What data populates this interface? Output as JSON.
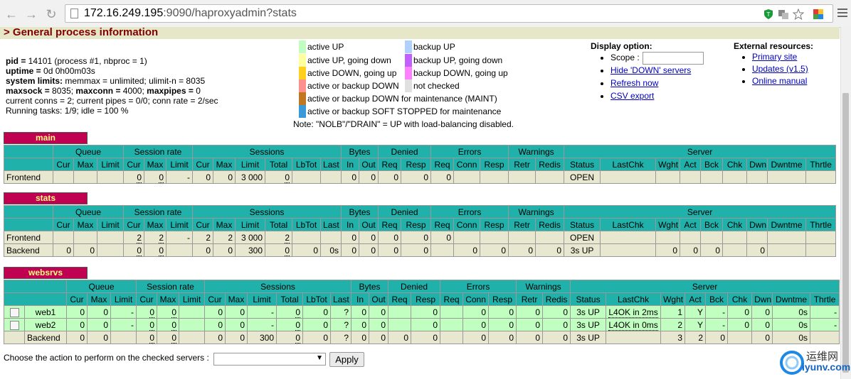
{
  "browser": {
    "url_host": "172.16.249.195",
    "url_rest": ":9090/haproxyadmin?stats"
  },
  "header": {
    "title": "> General process information"
  },
  "process": {
    "pid_label": "pid = ",
    "pid_value": "14101 (process #1, nbproc = 1)",
    "uptime_label": "uptime = ",
    "uptime_value": "0d 0h00m03s",
    "limits_label": "system limits:",
    "limits_value": " memmax = unlimited; ulimit-n = 8035",
    "maxsock_label": "maxsock = ",
    "maxsock_value": "8035; ",
    "maxconn_label": "maxconn = ",
    "maxconn_value": "4000; ",
    "maxpipes_label": "maxpipes = ",
    "maxpipes_value": "0",
    "conns": "current conns = 2; current pipes = 0/0; conn rate = 2/sec",
    "tasks": "Running tasks: 1/9; idle = 100 %"
  },
  "legend": {
    "items": [
      {
        "text": "active UP",
        "color": "#c0ffc0"
      },
      {
        "text": "active UP, going down",
        "color": "#ffffa0"
      },
      {
        "text": "active DOWN, going up",
        "color": "#ffd020"
      },
      {
        "text": "active or backup DOWN",
        "color": "#ff9090"
      },
      {
        "text": "active or backup DOWN for maintenance (MAINT)",
        "color": "#c07820"
      },
      {
        "text": "active or backup SOFT STOPPED for maintenance",
        "color": "#3a9ad9"
      },
      {
        "text": "backup UP",
        "color": "#b0d0ff"
      },
      {
        "text": "backup UP, going down",
        "color": "#c060ff"
      },
      {
        "text": "backup DOWN, going up",
        "color": "#ff80ff"
      },
      {
        "text": "not checked",
        "color": "#e0e0e0"
      }
    ],
    "note": "Note: \"NOLB\"/\"DRAIN\" = UP with load-balancing disabled."
  },
  "display_options": {
    "title": "Display option:",
    "scope_label": "Scope :",
    "links": [
      "Hide 'DOWN' servers",
      "Refresh now",
      "CSV export"
    ]
  },
  "external": {
    "title": "External resources:",
    "links": [
      "Primary site",
      "Updates (v1.5)",
      "Online manual"
    ]
  },
  "table_headers": {
    "groups": [
      "",
      "Queue",
      "Session rate",
      "Sessions",
      "Bytes",
      "Denied",
      "Errors",
      "Warnings",
      "Server"
    ],
    "cols": [
      "Cur",
      "Max",
      "Limit",
      "Cur",
      "Max",
      "Limit",
      "Cur",
      "Max",
      "Limit",
      "Total",
      "LbTot",
      "Last",
      "In",
      "Out",
      "Req",
      "Resp",
      "Req",
      "Conn",
      "Resp",
      "Retr",
      "Redis",
      "Status",
      "LastChk",
      "Wght",
      "Act",
      "Bck",
      "Chk",
      "Dwn",
      "Dwntme",
      "Thrtle"
    ]
  },
  "proxies": {
    "main": {
      "name": "main",
      "rows": [
        {
          "label": "Frontend",
          "cells": [
            "",
            "",
            "",
            "0",
            "0",
            "-",
            "0",
            "0",
            "3 000",
            "0",
            "",
            "",
            "0",
            "0",
            "0",
            "0",
            "0",
            "",
            "",
            "",
            "",
            "OPEN",
            "",
            "",
            "",
            "",
            "",
            "",
            "",
            ""
          ]
        }
      ]
    },
    "stats": {
      "name": "stats",
      "rows": [
        {
          "label": "Frontend",
          "cells": [
            "",
            "",
            "",
            "2",
            "2",
            "-",
            "2",
            "2",
            "3 000",
            "2",
            "",
            "",
            "0",
            "0",
            "0",
            "0",
            "0",
            "",
            "",
            "",
            "",
            "OPEN",
            "",
            "",
            "",
            "",
            "",
            "",
            "",
            ""
          ]
        },
        {
          "label": "Backend",
          "cells": [
            "0",
            "0",
            "",
            "0",
            "0",
            "",
            "0",
            "0",
            "300",
            "0",
            "0",
            "0s",
            "0",
            "0",
            "0",
            "0",
            "",
            "0",
            "0",
            "0",
            "0",
            "3s UP",
            "",
            "0",
            "0",
            "0",
            "",
            "0",
            "",
            ""
          ]
        }
      ]
    },
    "websrvs": {
      "name": "websrvs",
      "rows": [
        {
          "label": "web1",
          "cells": [
            "0",
            "0",
            "-",
            "0",
            "0",
            "",
            "0",
            "0",
            "-",
            "0",
            "0",
            "?",
            "0",
            "0",
            "",
            "0",
            "",
            "0",
            "0",
            "0",
            "0",
            "3s UP",
            "L4OK in 2ms",
            "1",
            "Y",
            "-",
            "0",
            "0",
            "0s",
            "-"
          ]
        },
        {
          "label": "web2",
          "cells": [
            "0",
            "0",
            "-",
            "0",
            "0",
            "",
            "0",
            "0",
            "-",
            "0",
            "0",
            "?",
            "0",
            "0",
            "",
            "0",
            "",
            "0",
            "0",
            "0",
            "0",
            "3s UP",
            "L4OK in 0ms",
            "2",
            "Y",
            "-",
            "0",
            "0",
            "0s",
            "-"
          ]
        },
        {
          "label": "Backend",
          "cells": [
            "0",
            "0",
            "",
            "0",
            "0",
            "",
            "0",
            "0",
            "300",
            "0",
            "0",
            "?",
            "0",
            "0",
            "0",
            "0",
            "",
            "0",
            "0",
            "0",
            "0",
            "3s UP",
            "",
            "3",
            "2",
            "0",
            "",
            "0",
            "0s",
            ""
          ]
        }
      ]
    }
  },
  "action": {
    "label": "Choose the action to perform on the checked servers :",
    "selected": "",
    "apply": "Apply"
  },
  "watermark": {
    "line1": "运维网",
    "line2": "iyunv.com"
  }
}
